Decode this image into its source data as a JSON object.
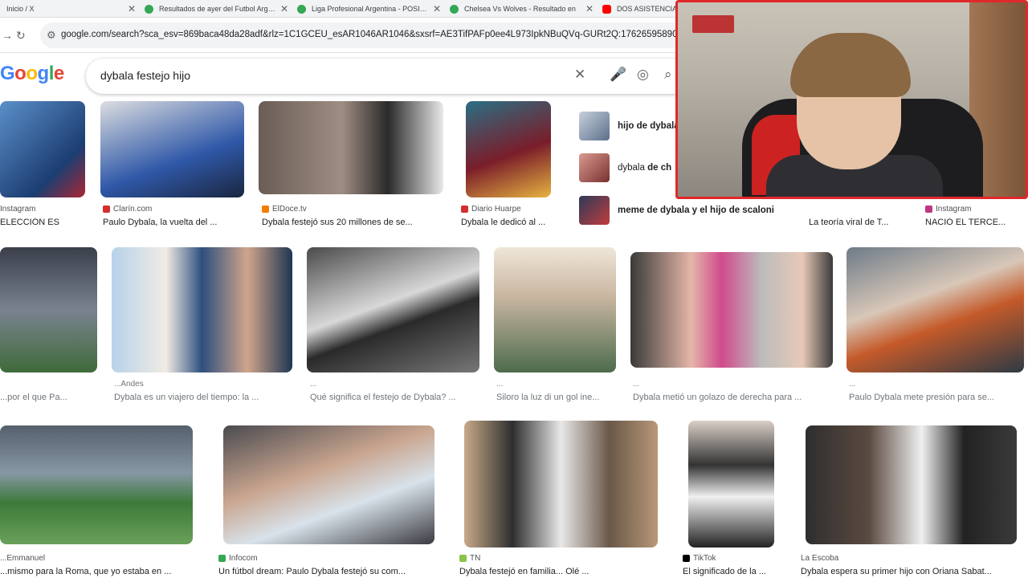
{
  "tabs": [
    {
      "title": "Inicio / X",
      "color": "#000000"
    },
    {
      "title": "Resultados de ayer del Futbol Argentino",
      "color": "#34a853"
    },
    {
      "title": "Liga Profesional Argentina - POSICIONES",
      "color": "#34a853"
    },
    {
      "title": "Chelsea Vs Wolves - Resultado en",
      "color": "#34a853"
    },
    {
      "title": "DOS ASISTENCIAS",
      "color": "#ff0000"
    }
  ],
  "address_bar": {
    "url": "google.com/search?sca_esv=869baca48da28adf&rlz=1C1GCEU_esAR1046AR1046&sxsrf=AE3TifPAFp0ee4L973IpkNBuQVq-GURt2Q:1762659589075&udm="
  },
  "search": {
    "query": "dybala festejo hijo"
  },
  "logo": [
    "G",
    "o",
    "o",
    "g",
    "l",
    "e"
  ],
  "related": [
    {
      "bold": "hijo de dybala",
      "rest": ""
    },
    {
      "bold": "",
      "prefix": "dybala ",
      "boldmid": "de ch",
      "rest": ""
    },
    {
      "bold": "meme de dybala y el hijo de scaloni",
      "rest": ""
    }
  ],
  "row1": [
    {
      "source": "Instagram",
      "caption": "ELECCIÓN ES",
      "icon_color": "#c13584"
    },
    {
      "source": "Clarín.com",
      "caption": "Paulo Dybala, la vuelta del ...",
      "icon_color": "#d32f2f"
    },
    {
      "source": "ElDoce.tv",
      "caption": "Dybala festejó sus 20 millones de se...",
      "icon_color": "#f57c00"
    },
    {
      "source": "Diario Huarpe",
      "caption": "Dybala le dedicó al ...",
      "icon_color": "#d32f2f"
    },
    {
      "source": "",
      "caption": "La teoría viral de T...",
      "icon_color": "#9e9e9e"
    },
    {
      "source": "Instagram",
      "caption": "NACIÓ EL TERCE...",
      "icon_color": "#c13584"
    }
  ],
  "row2": [
    {
      "source": "",
      "caption": "...por el que Pa..."
    },
    {
      "source": "...Andes",
      "caption": "Dybala es un viajero del tiempo: la ..."
    },
    {
      "source": "...",
      "caption": "Qué significa el festejo de Dybala? ..."
    },
    {
      "source": "...",
      "caption": "Siloro la luz di un gol ine..."
    },
    {
      "source": "...",
      "caption": "Dybala metió un golazo de derecha para ..."
    },
    {
      "source": "...",
      "caption": "Paulo Dybala mete presión para se..."
    }
  ],
  "row3": [
    {
      "source": "...Emmanuel",
      "caption": "...mismo para la Roma, que yo estaba en ...",
      "icon_color": "#9e9e9e"
    },
    {
      "source": "Infocom",
      "caption": "Un fútbol dream: Paulo Dybala festejó su com...",
      "icon_color": "#34a853"
    },
    {
      "source": "TN",
      "caption": "Dybala festejó en familia... Olé ... ",
      "icon_color": "#8bc34a"
    },
    {
      "source": "TikTok",
      "caption": "El significado de la ...",
      "icon_color": "#000000"
    },
    {
      "source": "La Escoba",
      "caption": "Dybala espera su primer hijo con Oriana Sabat...",
      "icon_color": "#9e9e9e"
    }
  ]
}
